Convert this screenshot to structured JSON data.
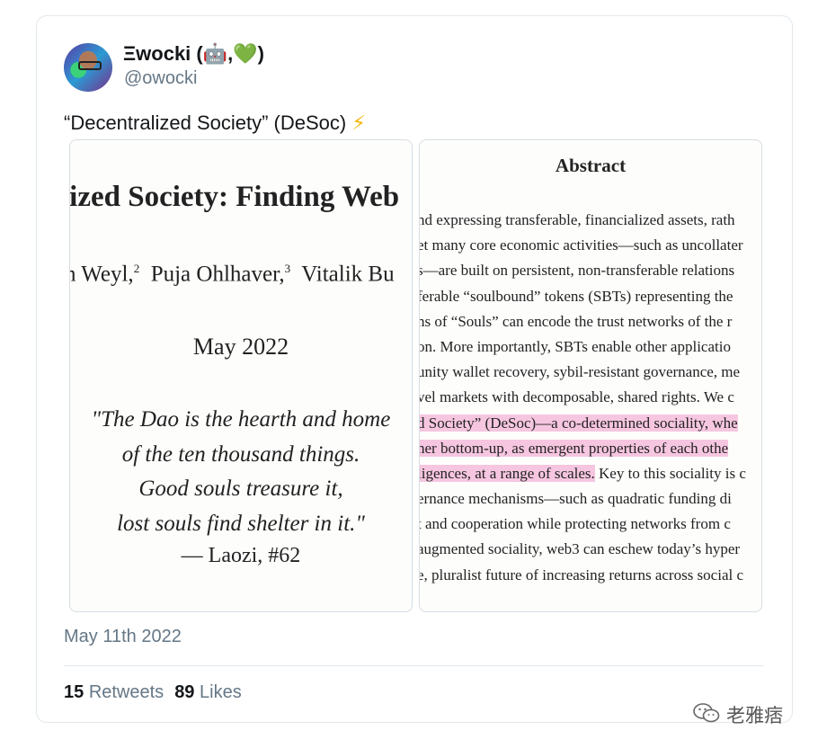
{
  "tweet": {
    "author_name": "Ξwocki (🤖,💚)",
    "handle": "@owocki",
    "text": "“Decentralized Society” (DeSoc)",
    "text_emoji": "⚡",
    "date": "May 11th 2022",
    "retweets_count": "15",
    "retweets_label": "Retweets",
    "likes_count": "89",
    "likes_label": "Likes"
  },
  "media_left": {
    "title": "lized Society: Finding Web",
    "authors": {
      "a1": "n Weyl,",
      "s1": "2",
      "a2": "Puja Ohlhaver,",
      "s2": "3",
      "a3": "Vitalik Bu"
    },
    "date": "May 2022",
    "quote_lines": [
      "\"The Dao is the hearth and home",
      "of the ten thousand things.",
      "Good souls treasure it,",
      "lost souls find shelter in it.\""
    ],
    "attribution": "— Laozi, #62"
  },
  "media_right": {
    "heading": "Abstract",
    "lines": [
      "nd expressing transferable, financialized assets, rath",
      "et many core economic activities—such as uncollater",
      "s—are built on persistent, non-transferable relations",
      "ferable “soulbound” tokens (SBTs) representing the",
      "ns of “Souls” can encode the trust networks of the r",
      "on.  More importantly, SBTs enable other applicatio",
      "unity wallet recovery, sybil-resistant governance, me",
      "vel markets with decomposable, shared rights.  We c",
      "d Society” (DeSoc)—a co-determined sociality, whe",
      "her bottom-up, as emergent properties of each othe",
      "ligences, at a range of scales.",
      "ernance mechanisms—such as quadratic funding di",
      "t and cooperation while protecting networks from c",
      "augmented sociality, web3 can eschew today’s hyper",
      "e, pluralist future of increasing returns across social c"
    ],
    "line11_tail": "  Key to this sociality is c",
    "highlight_color": "#f6c6e0"
  },
  "watermark": {
    "label": "老雅痞",
    "icon": "wechat-icon"
  },
  "colors": {
    "muted_text": "#657786",
    "bolt": "#f5b50a",
    "border": "#e1e8ed"
  }
}
